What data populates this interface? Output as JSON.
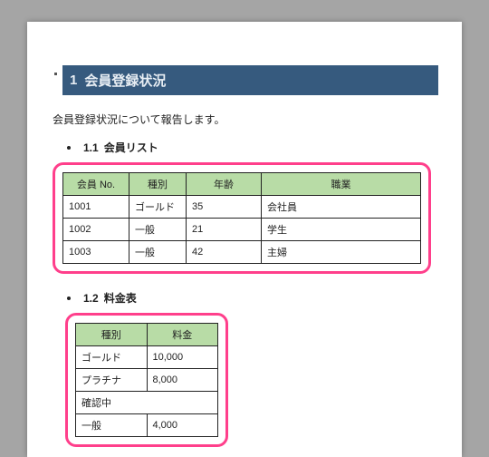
{
  "heading": {
    "number": "1",
    "title": "会員登録状況"
  },
  "intro": "会員登録状況について報告します。",
  "section1": {
    "number": "1.1",
    "title": "会員リスト"
  },
  "table1": {
    "headers": [
      "会員 No.",
      "種別",
      "年齢",
      "職業"
    ],
    "rows": [
      {
        "c0": "1001",
        "c1": "ゴールド",
        "c2": "35",
        "c3": "会社員"
      },
      {
        "c0": "1002",
        "c1": "一般",
        "c2": "21",
        "c3": "学生"
      },
      {
        "c0": "1003",
        "c1": "一般",
        "c2": "42",
        "c3": "主婦"
      }
    ]
  },
  "section2": {
    "number": "1.2",
    "title": "料金表"
  },
  "table2": {
    "headers": [
      "種別",
      "料金"
    ],
    "rows": [
      {
        "c0": "ゴールド",
        "c1": "10,000"
      },
      {
        "c0": "プラチナ",
        "c1": "8,000"
      },
      {
        "c0": "確認中",
        "c1": null
      },
      {
        "c0": "一般",
        "c1": "4,000"
      }
    ]
  }
}
